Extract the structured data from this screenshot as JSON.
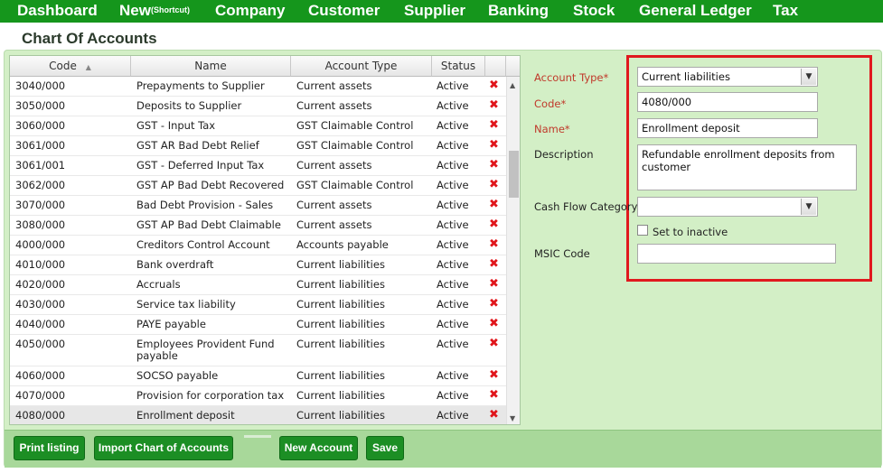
{
  "nav": {
    "items": [
      "Dashboard",
      "New",
      "Company",
      "Customer",
      "Supplier",
      "Banking",
      "Stock",
      "General Ledger",
      "Tax"
    ],
    "new_sup": "(Shortcut)"
  },
  "page": {
    "title": "Chart Of Accounts"
  },
  "grid": {
    "columns": [
      "Code",
      "Name",
      "Account Type",
      "Status"
    ],
    "sort_indicator": "▲",
    "delete_glyph": "✖",
    "rows": [
      {
        "code": "3040/000",
        "name": "Prepayments to Supplier",
        "type": "Current assets",
        "status": "Active"
      },
      {
        "code": "3050/000",
        "name": "Deposits to Supplier",
        "type": "Current assets",
        "status": "Active"
      },
      {
        "code": "3060/000",
        "name": "GST - Input Tax",
        "type": "GST Claimable Control",
        "status": "Active"
      },
      {
        "code": "3061/000",
        "name": "GST AR Bad Debt Relief",
        "type": "GST Claimable Control",
        "status": "Active"
      },
      {
        "code": "3061/001",
        "name": "GST - Deferred Input Tax",
        "type": "Current assets",
        "status": "Active"
      },
      {
        "code": "3062/000",
        "name": "GST AP Bad Debt Recovered",
        "type": "GST Claimable Control",
        "status": "Active"
      },
      {
        "code": "3070/000",
        "name": "Bad Debt Provision - Sales",
        "type": "Current assets",
        "status": "Active"
      },
      {
        "code": "3080/000",
        "name": "GST AP Bad Debt Claimable",
        "type": "Current assets",
        "status": "Active"
      },
      {
        "code": "4000/000",
        "name": "Creditors Control Account",
        "type": "Accounts payable",
        "status": "Active"
      },
      {
        "code": "4010/000",
        "name": "Bank overdraft",
        "type": "Current liabilities",
        "status": "Active"
      },
      {
        "code": "4020/000",
        "name": "Accruals",
        "type": "Current liabilities",
        "status": "Active"
      },
      {
        "code": "4030/000",
        "name": "Service tax liability",
        "type": "Current liabilities",
        "status": "Active"
      },
      {
        "code": "4040/000",
        "name": "PAYE payable",
        "type": "Current liabilities",
        "status": "Active"
      },
      {
        "code": "4050/000",
        "name": "Employees Provident Fund payable",
        "type": "Current liabilities",
        "status": "Active"
      },
      {
        "code": "4060/000",
        "name": "SOCSO payable",
        "type": "Current liabilities",
        "status": "Active"
      },
      {
        "code": "4070/000",
        "name": "Provision for corporation tax",
        "type": "Current liabilities",
        "status": "Active"
      },
      {
        "code": "4080/000",
        "name": "Enrollment deposit",
        "type": "Current liabilities",
        "status": "Active"
      }
    ]
  },
  "form": {
    "account_type_label": "Account Type*",
    "account_type_value": "Current liabilities",
    "code_label": "Code*",
    "code_value": "4080/000",
    "name_label": "Name*",
    "name_value": "Enrollment deposit",
    "description_label": "Description",
    "description_value": "Refundable enrollment deposits from customer",
    "cash_flow_label": "Cash Flow Category",
    "cash_flow_value": "",
    "inactive_label": "Set to inactive",
    "msic_label": "MSIC Code",
    "msic_value": ""
  },
  "buttons": {
    "print": "Print listing",
    "import": "Import Chart of Accounts",
    "new_account": "New Account",
    "save": "Save"
  },
  "icons": {
    "select_arrow": "▼",
    "scroll_up": "▲",
    "scroll_down": "▼"
  },
  "colors": {
    "nav_bg": "#15961c",
    "panel_bg": "#d3efc6",
    "button_bg": "#1c8e24",
    "delete_red": "#e0151b",
    "highlight_border": "#e0191e"
  }
}
